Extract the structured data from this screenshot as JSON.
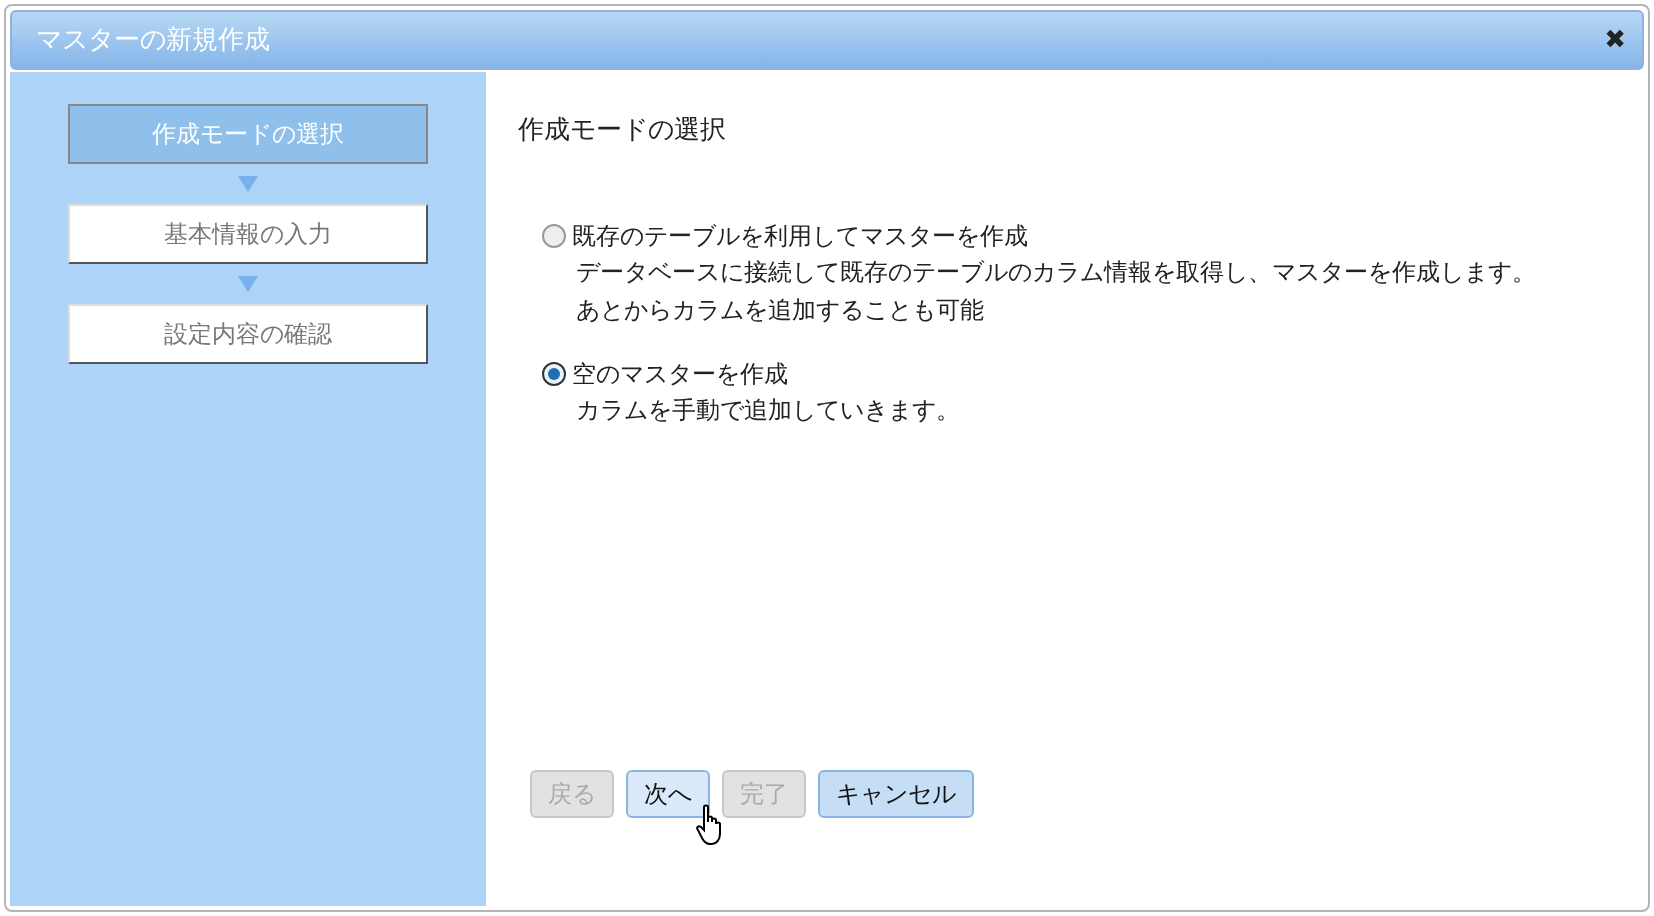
{
  "window": {
    "title": "マスターの新規作成",
    "close": "✖"
  },
  "steps": [
    {
      "label": "作成モードの選択",
      "selected": true
    },
    {
      "label": "基本情報の入力",
      "selected": false
    },
    {
      "label": "設定内容の確認",
      "selected": false
    }
  ],
  "heading": "作成モードの選択",
  "options": [
    {
      "label": "既存のテーブルを利用してマスターを作成",
      "description": [
        "データベースに接続して既存のテーブルのカラム情報を取得し、マスターを作成します。",
        "あとからカラムを追加することも可能"
      ],
      "selected": false
    },
    {
      "label": "空のマスターを作成",
      "description": [
        "カラムを手動で追加していきます。"
      ],
      "selected": true
    }
  ],
  "buttons": [
    {
      "label": "戻る",
      "disabled": true,
      "hovered": false
    },
    {
      "label": "次へ",
      "disabled": false,
      "hovered": true
    },
    {
      "label": "完了",
      "disabled": true,
      "hovered": false
    },
    {
      "label": "キャンセル",
      "disabled": false,
      "hovered": false
    }
  ]
}
